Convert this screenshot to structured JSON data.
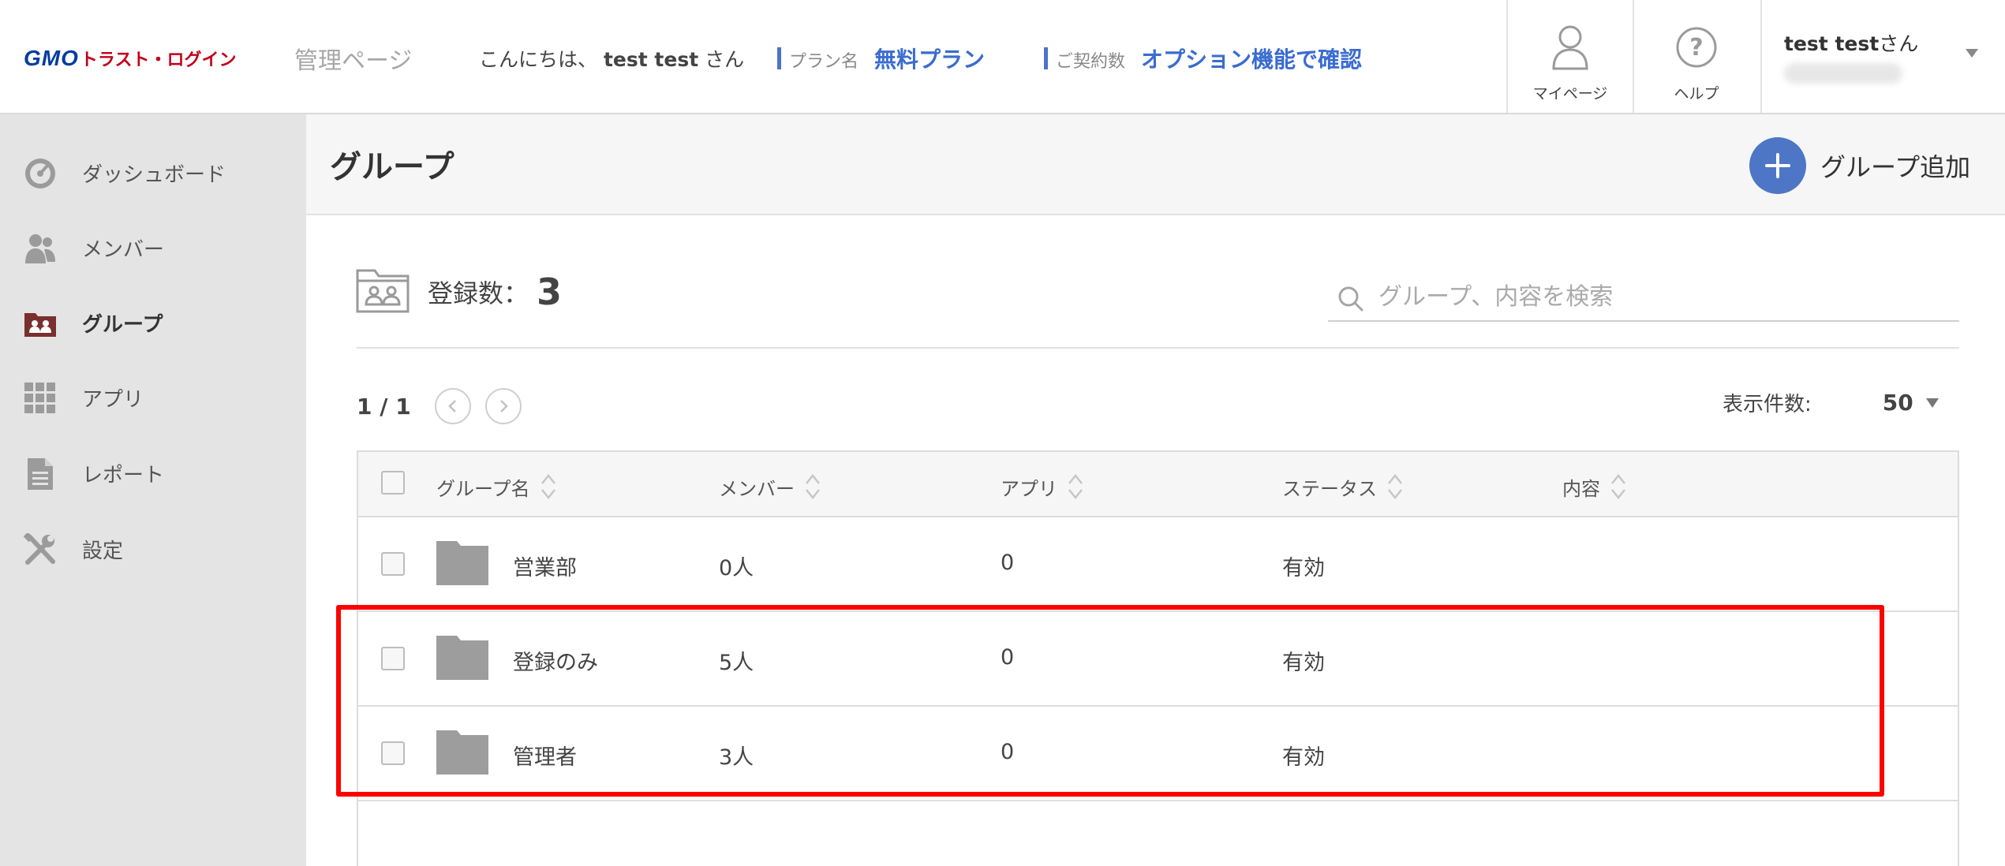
{
  "header": {
    "logo_main": "GMO",
    "logo_sub": "トラスト・ログイン",
    "admin_title": "管理ページ",
    "greeting_prefix": "こんにちは、",
    "greeting_name": "test test",
    "greeting_suffix": "さん",
    "plan_key": "プラン名",
    "plan_value": "無料プラン",
    "contract_key": "ご契約数",
    "contract_value": "オプション機能で確認",
    "mypage_label": "マイページ",
    "help_label": "ヘルプ",
    "user_name": "test test",
    "user_suffix": "さん"
  },
  "sidebar": {
    "items": [
      {
        "label": "ダッシュボード",
        "icon": "dashboard-icon",
        "active": false
      },
      {
        "label": "メンバー",
        "icon": "members-icon",
        "active": false
      },
      {
        "label": "グループ",
        "icon": "group-icon",
        "active": true
      },
      {
        "label": "アプリ",
        "icon": "apps-grid-icon",
        "active": false
      },
      {
        "label": "レポート",
        "icon": "report-icon",
        "active": false
      },
      {
        "label": "設定",
        "icon": "settings-tools-icon",
        "active": false
      }
    ]
  },
  "main": {
    "title": "グループ",
    "add_button": "グループ追加",
    "count_label": "登録数：",
    "count_value": "3",
    "search_placeholder": "グループ、内容を検索",
    "pager_text": "1 / 1",
    "per_page_label": "表示件数:",
    "per_page_value": "50",
    "columns": [
      "グループ名",
      "メンバー",
      "アプリ",
      "ステータス",
      "内容"
    ],
    "rows": [
      {
        "name": "営業部",
        "members": "0人",
        "apps": "0",
        "status": "有効",
        "content": ""
      },
      {
        "name": "登録のみ",
        "members": "5人",
        "apps": "0",
        "status": "有効",
        "content": ""
      },
      {
        "name": "管理者",
        "members": "3人",
        "apps": "0",
        "status": "有効",
        "content": ""
      }
    ]
  },
  "colors": {
    "accent_blue": "#4d76c6",
    "logo_red": "#c4001a",
    "group_icon": "#7a2f2f",
    "highlight": "#ff0000"
  }
}
